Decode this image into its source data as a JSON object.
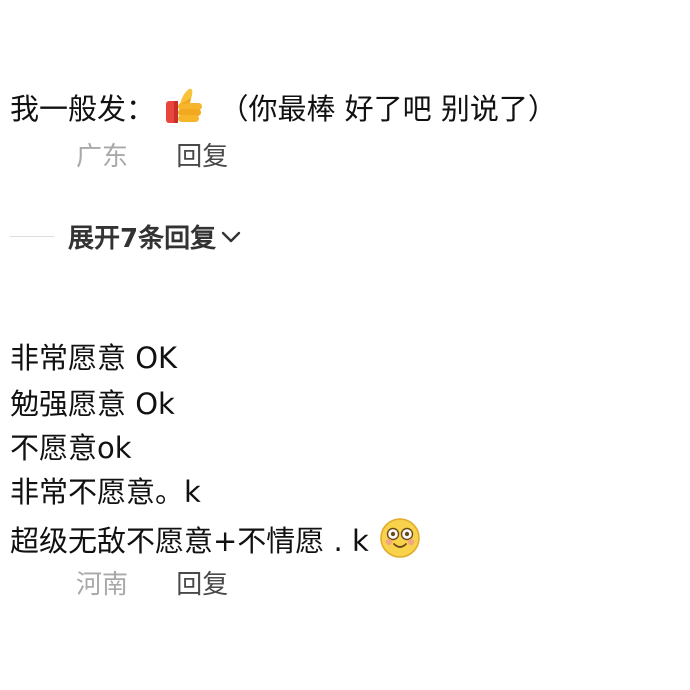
{
  "comment_1": {
    "text_before_icon": "我一般发：",
    "icon": "thumbs-up-emoji",
    "text_after_icon": "（你最棒 好了吧 别说了）",
    "location": "广东",
    "reply_label": "回复"
  },
  "replies_toggle": {
    "label": "展开7条回复",
    "icon": "chevron-down-icon"
  },
  "comment_2": {
    "lines": [
      "非常愿意 OK",
      "勉强愿意 Ok",
      "不愿意ok",
      "非常不愿意。k",
      "超级无敌不愿意+不情愿 . k"
    ],
    "trailing_icon": "dizzy-smile-emoji",
    "location": "河南",
    "reply_label": "回复"
  }
}
